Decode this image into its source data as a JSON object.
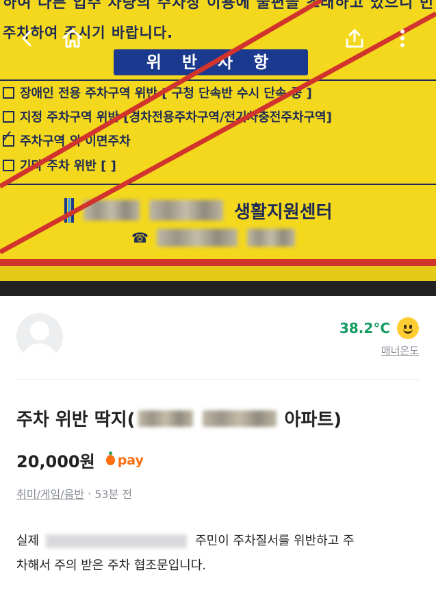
{
  "photo": {
    "top_text": "하여 다른 입주 차량의 주차장 이용에 불편을 초래하고 있으니 빈",
    "second_line": "주차하여 주시기 바랍니다.",
    "banner": "위반사항",
    "checkboxes": [
      {
        "label": "장애인 전용 주차구역 위반 [ 구청 단속반 수시 단속 중 ]",
        "checked": false
      },
      {
        "label": "지정 주차구역 위반 [경차전용주차구역/전기차충전주차구역]",
        "checked": false
      },
      {
        "label": "주차구역 외 이면주차",
        "checked": true
      },
      {
        "label": "기타 주차 위반 [                                   ]",
        "checked": false
      }
    ],
    "center_suffix": "생활지원센터",
    "phone_icon": "☎"
  },
  "nav": {
    "back_icon": "back-arrow-icon",
    "home_icon": "home-icon",
    "share_icon": "share-icon",
    "more_icon": "more-vertical-icon"
  },
  "profile": {
    "temperature": "38.2°C",
    "temperature_label": "매너온도",
    "temp_color": "#139b61"
  },
  "listing": {
    "title_prefix": "주차 위반 딱지(",
    "title_suffix": "아파트)",
    "price": "20,000원",
    "pay_label": "pay",
    "category": "취미/게임/음반",
    "separator": "·",
    "time": "53분 전",
    "desc_prefix": "실제",
    "desc_line1_suffix": "주민이 주차질서를 위반하고 주",
    "desc_line2": "차해서 주의 받은 주차 협조문입니다."
  },
  "colors": {
    "pay_orange": "#ff6f0f",
    "sign_yellow": "#f4d81e",
    "sign_navy": "#1d2a55",
    "slash_red": "#d1342c"
  }
}
